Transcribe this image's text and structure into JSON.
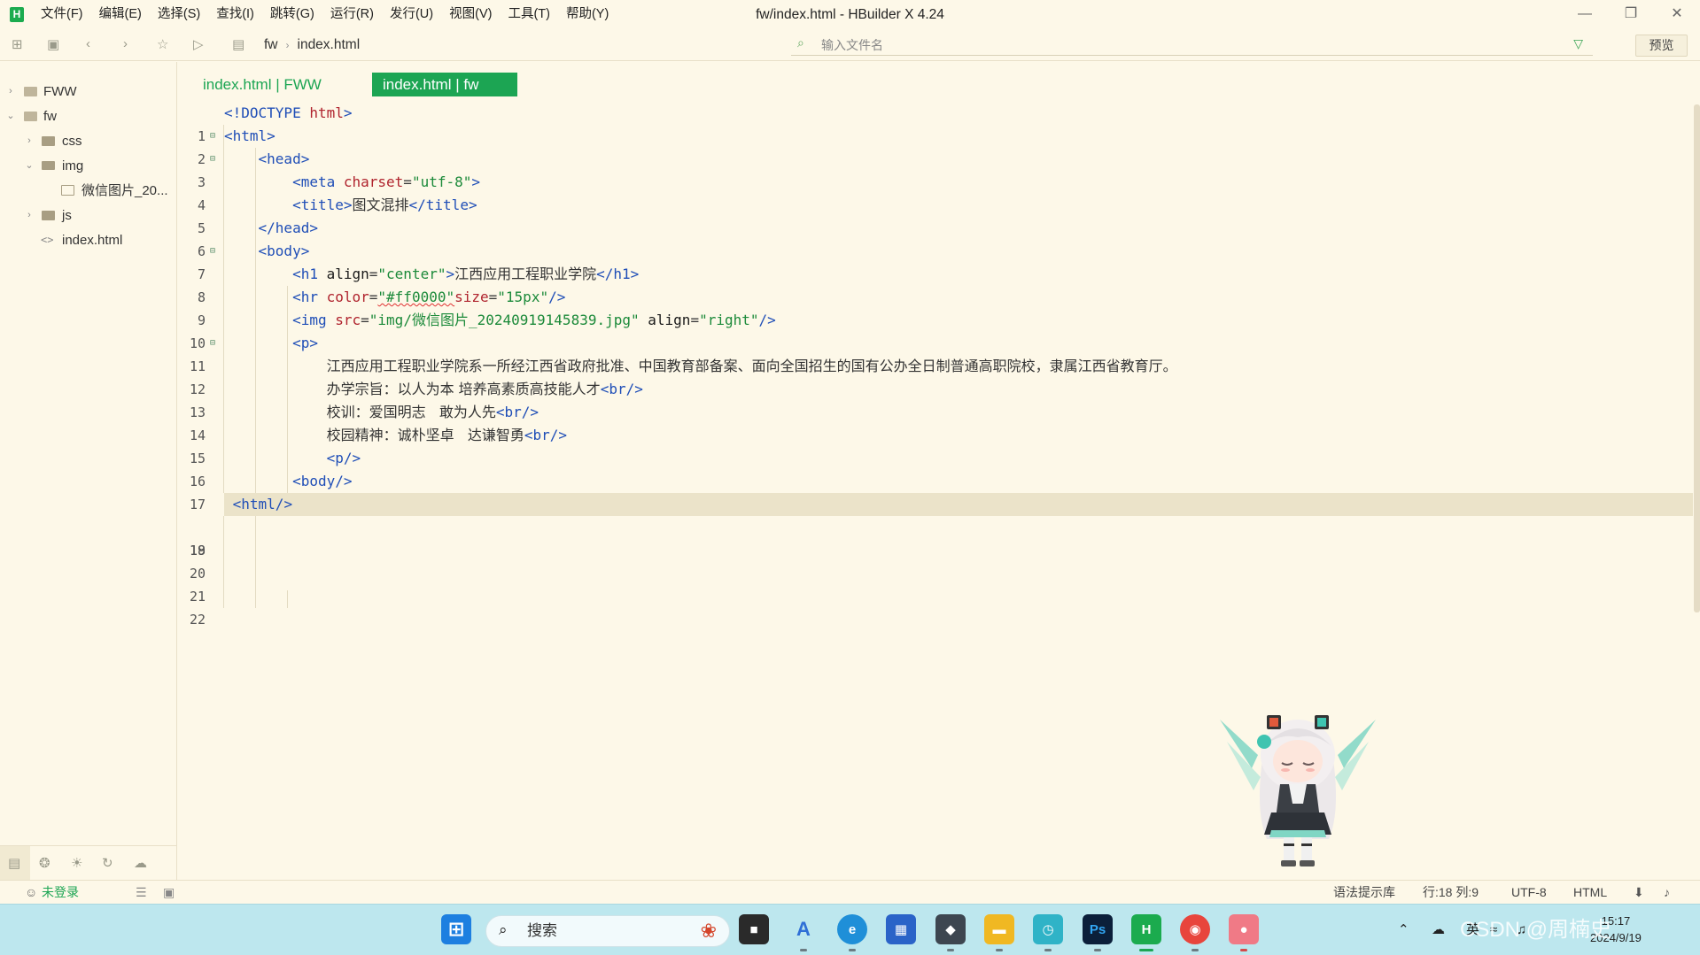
{
  "window": {
    "title": "fw/index.html - HBuilder X 4.24",
    "logo": "H",
    "minimize": "—",
    "restore": "❐",
    "close": "✕"
  },
  "menu": [
    "文件(F)",
    "编辑(E)",
    "选择(S)",
    "查找(I)",
    "跳转(G)",
    "运行(R)",
    "发行(U)",
    "视图(V)",
    "工具(T)",
    "帮助(Y)"
  ],
  "toolbar": {
    "breadcrumb": [
      "fw",
      "index.html"
    ],
    "file_filter_placeholder": "输入文件名",
    "preview_label": "预览"
  },
  "sidebar": {
    "tree": [
      {
        "label": "FWW",
        "kind": "project",
        "expanded": false
      },
      {
        "label": "fw",
        "kind": "project",
        "expanded": true
      },
      {
        "label": "css",
        "kind": "folder",
        "expanded": false
      },
      {
        "label": "img",
        "kind": "folder",
        "expanded": true
      },
      {
        "label": "微信图片_20...",
        "kind": "image"
      },
      {
        "label": "js",
        "kind": "folder",
        "expanded": false
      },
      {
        "label": "index.html",
        "kind": "html"
      }
    ]
  },
  "tabs": [
    {
      "label": "index.html | FWW",
      "active": false
    },
    {
      "label": "index.html | fw",
      "active": true
    }
  ],
  "editor": {
    "current_line": 18,
    "lines": [
      "<!DOCTYPE html>",
      "<html>",
      "    <head>",
      "        <meta charset=\"utf-8\">",
      "        <title>图文混排</title>",
      "    </head>",
      "    <body>",
      "        <h1 align=\"center\">江西应用工程职业学院</h1>",
      "        <hr color=\"#ff0000\"size=\"15px\"/>",
      "        <img src=\"img/微信图片_20240919145839.jpg\" align=\"right\"/>",
      "        <p>",
      "            江西应用工程职业学院系一所经江西省政府批准、中国教育部备案、面向全国招生的国有公办全日制普通高职院校，隶属江西省教育厅。",
      "            办学宗旨：以人为本 培养高素质高技能人才<br/>",
      "            校训：爱国明志   敢为人先<br/>",
      "            校园精神：诚朴坚卓   达谦智勇<br/>",
      "            <p/>",
      "        <body/>",
      " <html/>",
      "",
      "",
      "",
      ""
    ]
  },
  "statusbar": {
    "login": "未登录",
    "syntax_lib": "语法提示库",
    "position": "行:18  列:9",
    "encoding": "UTF-8",
    "language": "HTML"
  },
  "taskbar": {
    "search_label": "搜索",
    "ime": "英",
    "time": "15:17",
    "date": "2024/9/19",
    "watermark": "CSDN @周楠史"
  },
  "colors": {
    "accent": "#1ca553",
    "background": "#fdf8e8",
    "taskbar": "#bde7ee"
  }
}
